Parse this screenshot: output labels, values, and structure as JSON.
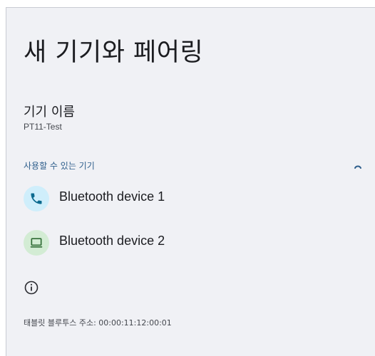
{
  "page": {
    "title": "새 기기와 페어링"
  },
  "device_name": {
    "label": "기기 이름",
    "value": "PT11-Test"
  },
  "available": {
    "header": "사용할 수 있는 기기",
    "scanning_icon": "progress-spinner-icon",
    "devices": [
      {
        "name": "Bluetooth device 1",
        "icon": "phone-icon",
        "icon_bg": "#cfeefb",
        "icon_color": "#0b6a8f"
      },
      {
        "name": "Bluetooth device 2",
        "icon": "laptop-icon",
        "icon_bg": "#d3ecd4",
        "icon_color": "#2f6b34"
      }
    ]
  },
  "footer": {
    "info_icon": "info-icon",
    "address_text": "태블릿 블루투스 주소: 00:00:11:12:00:01"
  },
  "colors": {
    "background": "#f0f1f5",
    "accent": "#2f5f8c",
    "text_primary": "#1b1c20",
    "text_secondary": "#44474e"
  }
}
